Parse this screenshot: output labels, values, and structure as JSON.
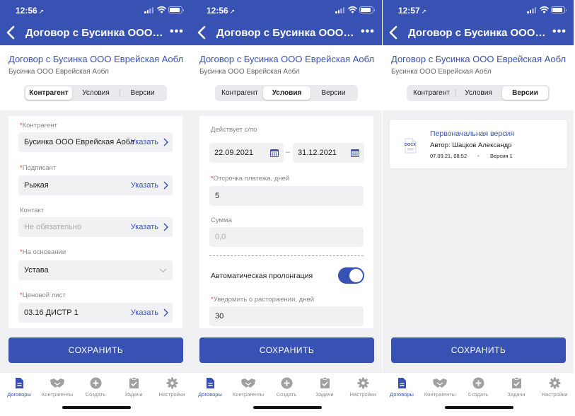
{
  "status": {
    "time_a": "12:56",
    "time_b": "12:57",
    "location_glyph": "➚"
  },
  "header": {
    "title": "Договор с Бусинка ООО Еврейская Аобл",
    "more_label": "•••"
  },
  "document": {
    "title": "Договор с Бусинка ООО Еврейская Аобл",
    "subtitle": "Бусинка ООО Еврейская Аобл"
  },
  "segments": [
    "Контрагент",
    "Условия",
    "Версии"
  ],
  "counterparty_tab": {
    "fields": [
      {
        "label": "Контрагент",
        "required": "*",
        "value": "Бусинка ООО Еврейская Аобл",
        "action": "Указать"
      },
      {
        "label": "Подписант",
        "required": "*",
        "value": "Рыжая",
        "action": "Указать"
      },
      {
        "label": "Контакт",
        "required": "",
        "placeholder": "Не обязательно",
        "action": "Указать"
      },
      {
        "label": "На основании",
        "required": "*",
        "value": "Устава"
      },
      {
        "label": "Ценовой лист",
        "required": "*",
        "value": "03.16 ДИСТР 1",
        "action": "Указать"
      }
    ]
  },
  "terms_tab": {
    "validity_label": "Действует с/по",
    "date_from": "22.09.2021",
    "date_to": "31.12.2021",
    "date_separator": "–",
    "payment_delay_label": "Отсрочка платежа, дней",
    "payment_delay_required": "*",
    "payment_delay_value": "5",
    "sum_label": "Сумма",
    "sum_placeholder": "0,0",
    "auto_prolong_label": "Автоматическая пролонгация",
    "auto_prolong_on": true,
    "notify_label": "Уведомить о расторжении, дней",
    "notify_required": "*",
    "notify_value": "30"
  },
  "versions_tab": {
    "versions": [
      {
        "name": "Первоначальная версия",
        "author": "Автор: Шацков Александр",
        "date": "07.09.21, 08:52",
        "dot": "•",
        "number": "Версия 1",
        "icon_label": "DOCX"
      }
    ]
  },
  "save_label": "СОХРАНИТЬ",
  "tabbar": [
    {
      "label": "Договоры",
      "icon": "document-icon"
    },
    {
      "label": "Контрагенты",
      "icon": "handshake-icon"
    },
    {
      "label": "Создать",
      "icon": "plus-circle-icon"
    },
    {
      "label": "Задачи",
      "icon": "task-check-icon"
    },
    {
      "label": "Настройки",
      "icon": "gear-icon"
    }
  ],
  "colors": {
    "brand": "#3852b3",
    "required": "#e53935",
    "field_bg": "#f1f1f4"
  }
}
